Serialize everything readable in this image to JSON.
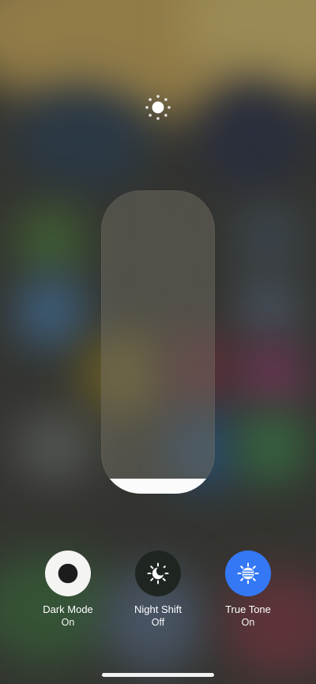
{
  "brightness": {
    "icon": "sun-icon",
    "level": 0.05
  },
  "toggles": [
    {
      "label": "Dark Mode",
      "state": "On",
      "icon": "dark-mode-icon",
      "active": true
    },
    {
      "label": "Night Shift",
      "state": "Off",
      "icon": "night-shift-icon",
      "active": false
    },
    {
      "label": "True Tone",
      "state": "On",
      "icon": "true-tone-icon",
      "active": true
    }
  ],
  "colors": {
    "dark_mode_bg": "#f4f4f2",
    "night_shift_bg": "#1f2622",
    "true_tone_bg": "#3478f6",
    "slider_fill": "#fbfbfb"
  }
}
